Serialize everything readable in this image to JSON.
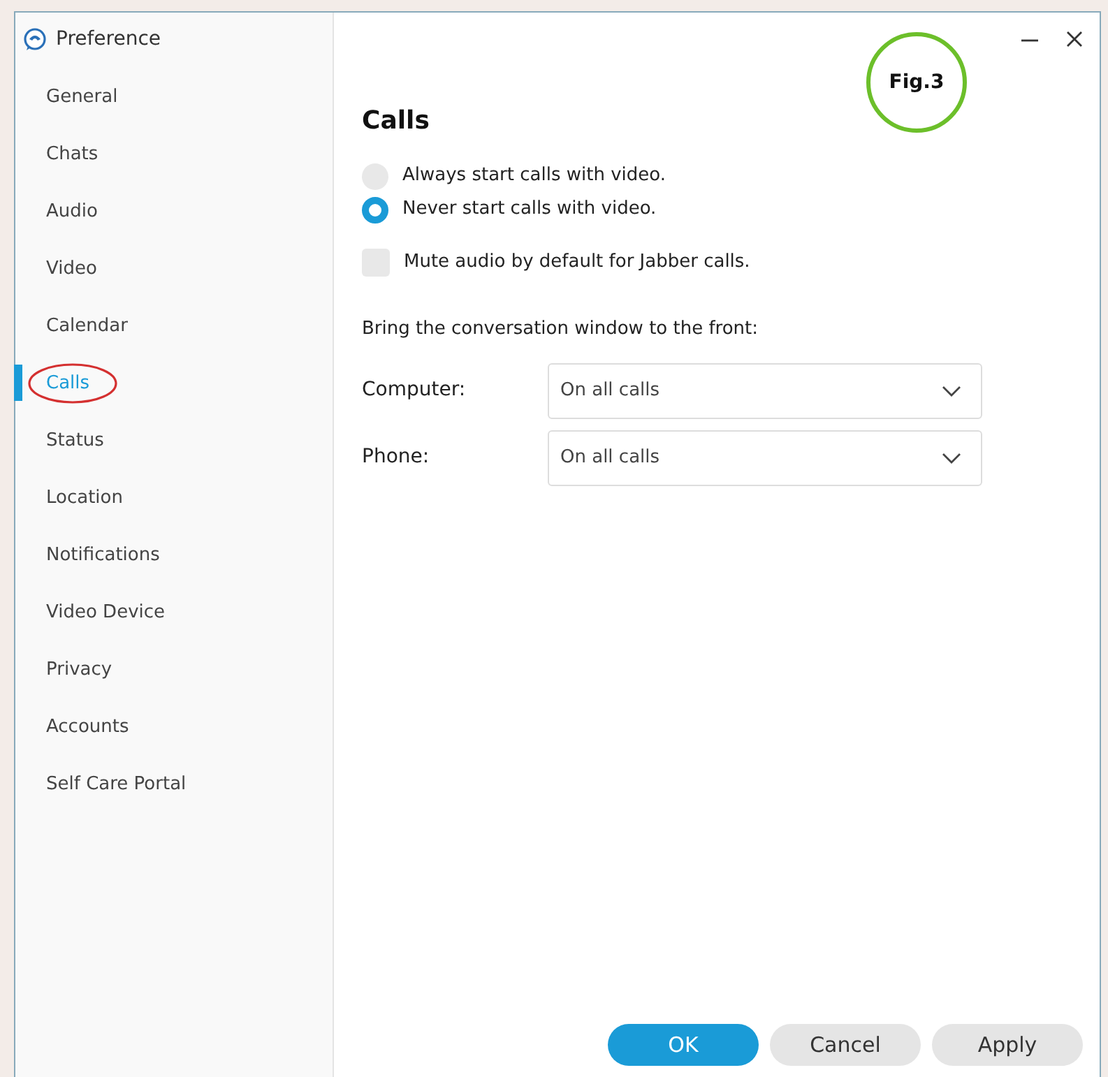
{
  "window": {
    "title": "Preference"
  },
  "sidebar": {
    "items": [
      {
        "label": "General",
        "selected": false
      },
      {
        "label": "Chats",
        "selected": false
      },
      {
        "label": "Audio",
        "selected": false
      },
      {
        "label": "Video",
        "selected": false
      },
      {
        "label": "Calendar",
        "selected": false
      },
      {
        "label": "Calls",
        "selected": true,
        "circled": true
      },
      {
        "label": "Status",
        "selected": false
      },
      {
        "label": "Location",
        "selected": false
      },
      {
        "label": "Notifications",
        "selected": false
      },
      {
        "label": "Video Device",
        "selected": false
      },
      {
        "label": "Privacy",
        "selected": false
      },
      {
        "label": "Accounts",
        "selected": false
      },
      {
        "label": "Self Care Portal",
        "selected": false
      }
    ]
  },
  "figure_label": "Fig.3",
  "section": {
    "title": "Calls",
    "options": [
      {
        "kind": "radio",
        "label": "Always start calls with video.",
        "selected": false
      },
      {
        "kind": "radio",
        "label": "Never start calls with video.",
        "selected": true
      },
      {
        "kind": "checkbox",
        "label": "Mute audio by default for Jabber calls.",
        "checked": false
      }
    ],
    "subheading": "Bring the conversation window to the front:",
    "dropdowns": [
      {
        "label": "Computer:",
        "value": "On all calls"
      },
      {
        "label": "Phone:",
        "value": "On all calls"
      }
    ]
  },
  "buttons": [
    {
      "label": "OK",
      "primary": true
    },
    {
      "label": "Cancel",
      "primary": false
    },
    {
      "label": "Apply",
      "primary": false
    }
  ]
}
